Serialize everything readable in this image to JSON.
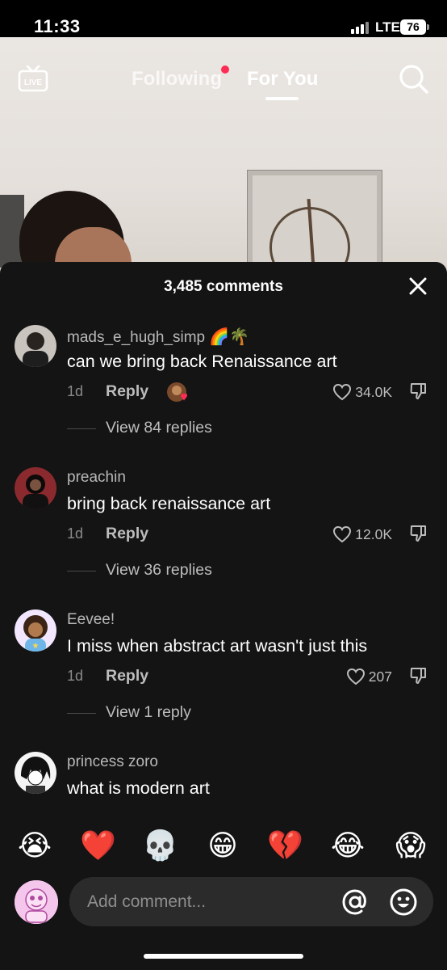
{
  "status_bar": {
    "time": "11:33",
    "network": "LTE",
    "battery": "76"
  },
  "top_nav": {
    "live_icon": "live-tv-icon",
    "tabs": [
      {
        "label": "Following",
        "has_notification_dot": true
      },
      {
        "label": "For You",
        "active": true
      }
    ],
    "search_icon": "search-icon"
  },
  "comments_sheet": {
    "title": "3,485 comments",
    "close_icon": "close-icon",
    "comments": [
      {
        "username": "mads_e_hugh_simp",
        "username_emoji": "🌈🌴",
        "text": "can we bring back Renaissance art",
        "time": "1d",
        "reply_label": "Reply",
        "creator_liked": true,
        "likes": "34.0K",
        "view_replies": "View 84 replies"
      },
      {
        "username": "preachin",
        "username_emoji": "",
        "text": "bring back renaissance art",
        "time": "1d",
        "reply_label": "Reply",
        "creator_liked": false,
        "likes": "12.0K",
        "view_replies": "View 36 replies"
      },
      {
        "username": "Eevee!",
        "username_emoji": "",
        "text": "I miss when abstract art wasn't just this",
        "time": "1d",
        "reply_label": "Reply",
        "creator_liked": false,
        "likes": "207",
        "view_replies": "View 1 reply"
      },
      {
        "username": "princess zoro",
        "username_emoji": "",
        "text": "what is modern art",
        "time": "",
        "reply_label": "",
        "creator_liked": false,
        "likes": "",
        "view_replies": ""
      }
    ]
  },
  "quick_emojis": [
    "😭",
    "❤️",
    "💀",
    "😁",
    "💔",
    "😂",
    "😱"
  ],
  "comment_input": {
    "placeholder": "Add comment...",
    "mention_icon": "at-sign-icon",
    "emoji_icon": "smiley-icon"
  },
  "colors": {
    "sheet_bg": "#141414",
    "accent_red": "#fe2c55",
    "input_bg": "#2b2b2b"
  }
}
